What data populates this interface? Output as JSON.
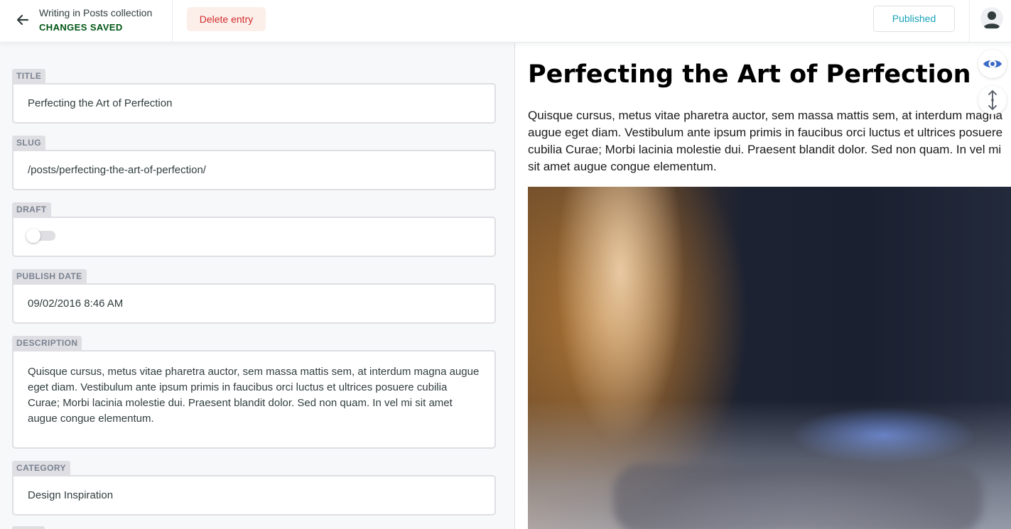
{
  "header": {
    "back_title": "Writing in Posts collection",
    "back_status": "CHANGES SAVED",
    "delete_label": "Delete entry",
    "publish_status_label": "Published"
  },
  "editor": {
    "fields": [
      {
        "label": "TITLE",
        "value": "Perfecting the Art of Perfection"
      },
      {
        "label": "SLUG",
        "value": "/posts/perfecting-the-art-of-perfection/"
      },
      {
        "label": "DRAFT",
        "value": false
      },
      {
        "label": "PUBLISH DATE",
        "value": "09/02/2016 8:46 AM"
      },
      {
        "label": "DESCRIPTION",
        "value": "Quisque cursus, metus vitae pharetra auctor, sem massa mattis sem, at interdum magna augue eget diam. Vestibulum ante ipsum primis in faucibus orci luctus et ultrices posuere cubilia Curae; Morbi lacinia molestie dui. Praesent blandit dolor. Sed non quam. In vel mi sit amet augue congue elementum."
      },
      {
        "label": "CATEGORY",
        "value": "Design Inspiration"
      }
    ]
  },
  "preview": {
    "title": "Perfecting the Art of Perfection",
    "body": "Quisque cursus, metus vitae pharetra auctor, sem massa mattis sem, at interdum magna augue eget diam. Vestibulum ante ipsum primis in faucibus orci luctus et ultrices posuere cubilia Curae; Morbi lacinia molestie dui. Praesent blandit dolor. Sed non quam. In vel mi sit amet augue congue elementum."
  },
  "icons": {
    "back": "arrow-left-icon",
    "avatar": "user-icon",
    "preview_toggle": "eye-icon",
    "scroll_sync": "scroll-sync-icon"
  },
  "colors": {
    "saved_status": "#005614",
    "delete_text": "#d02c2c",
    "delete_bg": "#fcefea",
    "published_text": "#17a2b8",
    "eye_icon": "#3a69c7",
    "label_bg": "#dfdfe3"
  }
}
